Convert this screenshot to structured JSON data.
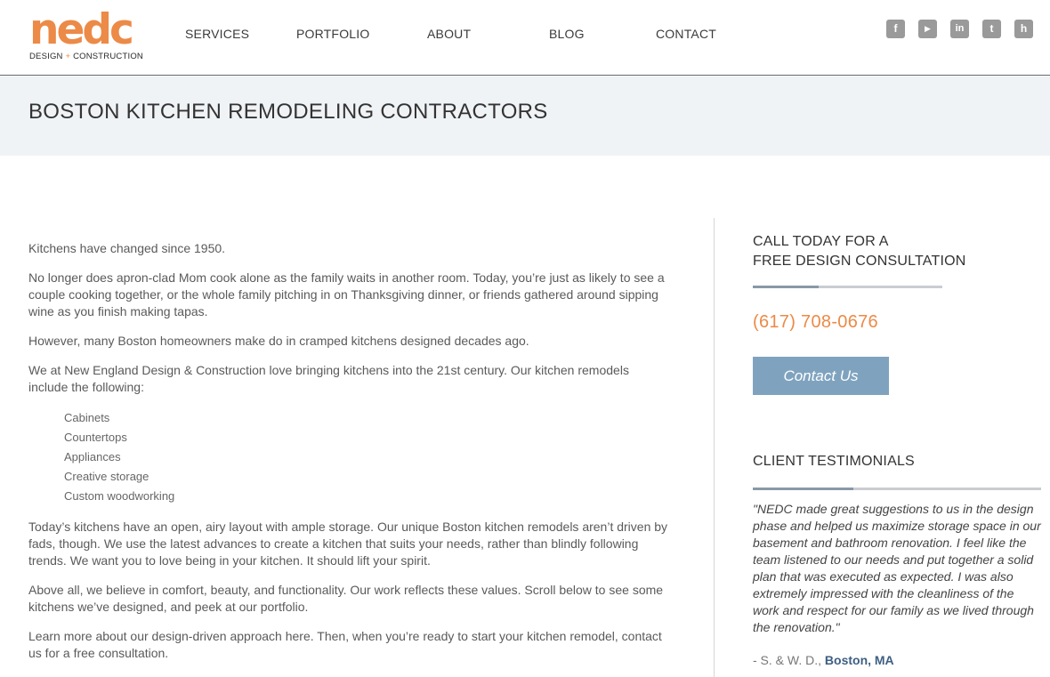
{
  "logo": {
    "word": "nedc",
    "sub_left": "DESIGN",
    "sub_plus": "+",
    "sub_right": "CONSTRUCTION"
  },
  "nav": [
    {
      "label": "SERVICES"
    },
    {
      "label": "PORTFOLIO"
    },
    {
      "label": "ABOUT"
    },
    {
      "label": "BLOG"
    },
    {
      "label": "CONTACT"
    }
  ],
  "social": [
    {
      "icon": "facebook-icon",
      "glyph": "f"
    },
    {
      "icon": "youtube-icon",
      "glyph": "▶"
    },
    {
      "icon": "linkedin-icon",
      "glyph": "in"
    },
    {
      "icon": "twitter-icon",
      "glyph": "t"
    },
    {
      "icon": "houzz-icon",
      "glyph": "h"
    }
  ],
  "page": {
    "title": "BOSTON KITCHEN REMODELING CONTRACTORS"
  },
  "content": {
    "p1": "Kitchens have changed since 1950.",
    "p2": "No longer does apron-clad Mom cook alone as the family waits in another room. Today, you’re just as likely to see a couple cooking together, or the whole family pitching in on Thanksgiving dinner, or friends gathered around sipping wine as you finish making tapas.",
    "p3": "However, many Boston homeowners make do in cramped kitchens designed decades ago.",
    "p4": "We at New England Design & Construction love bringing kitchens into the 21st century. Our kitchen remodels include the following:",
    "list": [
      "Cabinets",
      "Countertops",
      "Appliances",
      "Creative storage",
      "Custom woodworking"
    ],
    "p5": "Today’s kitchens have an open, airy layout with ample storage. Our unique Boston kitchen remodels aren’t driven by fads, though. We use the latest advances to create a kitchen that suits your needs, rather than blindly following trends. We want you to love being in your kitchen. It should lift your spirit.",
    "p6": "Above all, we believe in comfort, beauty, and functionality. Our work reflects these values. Scroll below to see some kitchens we’ve designed, and peek at our portfolio.",
    "p7": "Learn more about our design-driven approach here. Then, when you’re ready to start your kitchen remodel, contact us for a free consultation."
  },
  "sidebar": {
    "cta_line1": "CALL TODAY FOR A",
    "cta_line2": "FREE DESIGN CONSULTATION",
    "phone": "(617) 708-0676",
    "contact_button": "Contact Us",
    "testimonials_heading": "CLIENT TESTIMONIALS",
    "quote": "\"NEDC made great suggestions to us in the design phase and helped us maximize storage space in our basement and bathroom renovation. I feel like the team listened to our needs and put together a solid plan that was executed as expected. I was also extremely impressed with the cleanliness of the work and respect for our family as we lived through the renovation.\"",
    "attribution_name": "- S. & W. D., ",
    "attribution_place": "Boston, MA"
  },
  "colors": {
    "brand_orange": "#ec8a47",
    "button_blue": "#7fa3bf",
    "band_gray": "#f0f3f6",
    "link_blue": "#3d5f82"
  }
}
